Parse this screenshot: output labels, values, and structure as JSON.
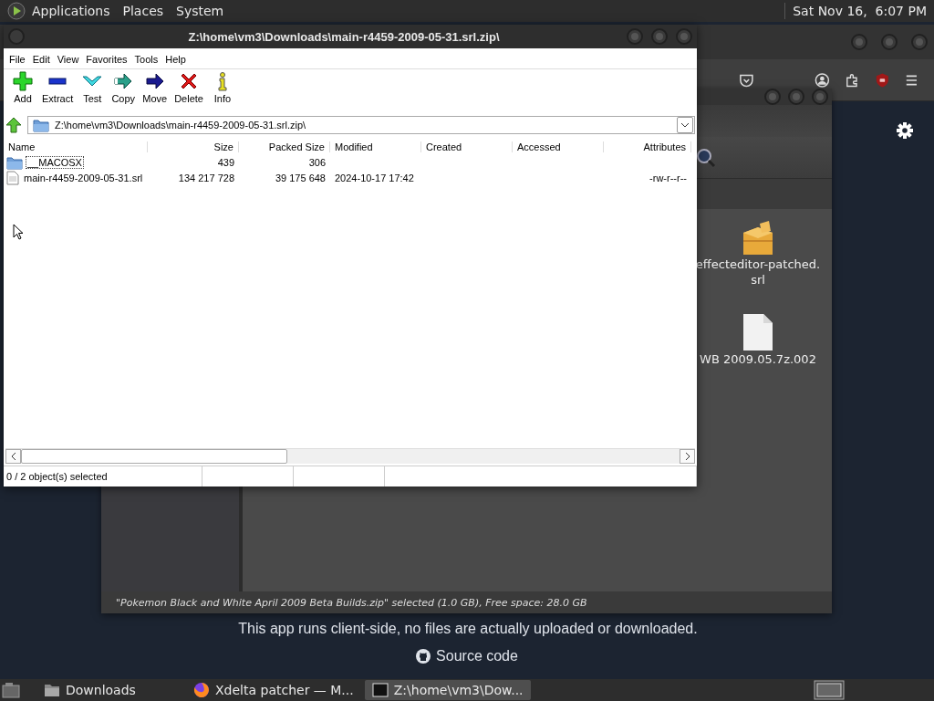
{
  "top_panel": {
    "menus": [
      "Applications",
      "Places",
      "System"
    ],
    "clock": "Sat Nov 16,  6:07 PM"
  },
  "web_page": {
    "notice": "This app runs client-side, no files are actually uploaded or downloaded.",
    "source_link": "Source code"
  },
  "file_manager": {
    "files": [
      {
        "name": "effecteditor-patched.srl",
        "kind": "package"
      },
      {
        "name": "WB 2009.05.7z.002",
        "kind": "document"
      }
    ],
    "status": "\"Pokemon Black and White April 2009 Beta Builds.zip\" selected (1.0 GB), Free space: 28.0 GB"
  },
  "archive_window": {
    "title": "Z:\\home\\vm3\\Downloads\\main-r4459-2009-05-31.srl.zip\\",
    "menu": [
      "File",
      "Edit",
      "View",
      "Favorites",
      "Tools",
      "Help"
    ],
    "toolbar": [
      {
        "label": "Add",
        "kind": "add"
      },
      {
        "label": "Extract",
        "kind": "extract"
      },
      {
        "label": "Test",
        "kind": "test"
      },
      {
        "label": "Copy",
        "kind": "copy"
      },
      {
        "label": "Move",
        "kind": "move"
      },
      {
        "label": "Delete",
        "kind": "delete"
      },
      {
        "label": "Info",
        "kind": "info"
      }
    ],
    "path": "Z:\\home\\vm3\\Downloads\\main-r4459-2009-05-31.srl.zip\\",
    "columns": [
      "Name",
      "Size",
      "Packed Size",
      "Modified",
      "Created",
      "Accessed",
      "Attributes"
    ],
    "rows": [
      {
        "kind": "folder",
        "focused": true,
        "name": "__MACOSX",
        "size": "439",
        "packed_size": "306"
      },
      {
        "kind": "file",
        "focused": false,
        "name": "main-r4459-2009-05-31.srl",
        "size": "134 217 728",
        "packed_size": "39 175 648",
        "modified": "2024-10-17 17:42",
        "attributes": "-rw-r--r--"
      }
    ],
    "status_bar": [
      "0 / 2 object(s) selected"
    ]
  },
  "taskbar": {
    "items": [
      {
        "label": "Downloads",
        "kind": "folder",
        "selected": false
      },
      {
        "label": "Xdelta patcher — M...",
        "kind": "browser",
        "selected": false
      },
      {
        "label": "Z:\\home\\vm3\\Dow...",
        "kind": "archiver",
        "selected": true
      }
    ]
  }
}
